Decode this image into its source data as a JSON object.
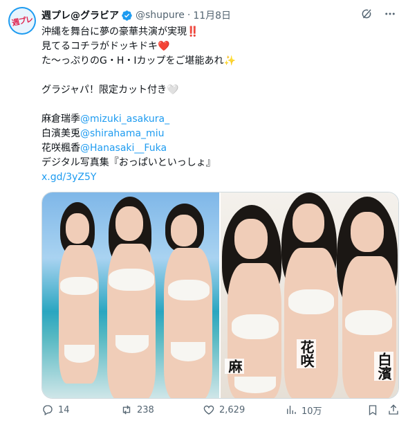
{
  "post": {
    "author": {
      "display_name": "週プレ@グラビア",
      "handle": "@shupure",
      "date": "11月8日",
      "avatar_text": "週プレ"
    },
    "separator": "·",
    "text_lines": [
      "沖縄を舞台に夢の豪華共演が実現‼️",
      "見てるコチラがドッキドキ❤️",
      "た〜っぷりのG・H・Iカップをご堪能あれ✨",
      "",
      "グラジャパ！限定カット付き🤍",
      ""
    ],
    "credits": [
      {
        "name": "麻倉瑞季",
        "mention": "@mizuki_asakura_"
      },
      {
        "name": "白濱美兎",
        "mention": "@shirahama_miu"
      },
      {
        "name": "花咲楓香",
        "mention": "@Hanasaki__Fuka"
      }
    ],
    "book_line": "デジタル写真集『おっぱいといっしょ』",
    "link": "x.gd/3yZ5Y",
    "media_captions": {
      "left": "麻",
      "center": "花咲",
      "right": "白濱"
    },
    "actions": {
      "replies": "14",
      "reposts": "238",
      "likes": "2,629",
      "views": "10万"
    }
  },
  "colors": {
    "accent": "#1d9bf0",
    "muted": "#536471",
    "text": "#0f1419",
    "border": "#cfd9de"
  },
  "icons": [
    "grok-icon",
    "more-icon",
    "verified-badge-icon",
    "reply-icon",
    "repost-icon",
    "like-icon",
    "views-icon",
    "bookmark-icon",
    "share-icon"
  ]
}
